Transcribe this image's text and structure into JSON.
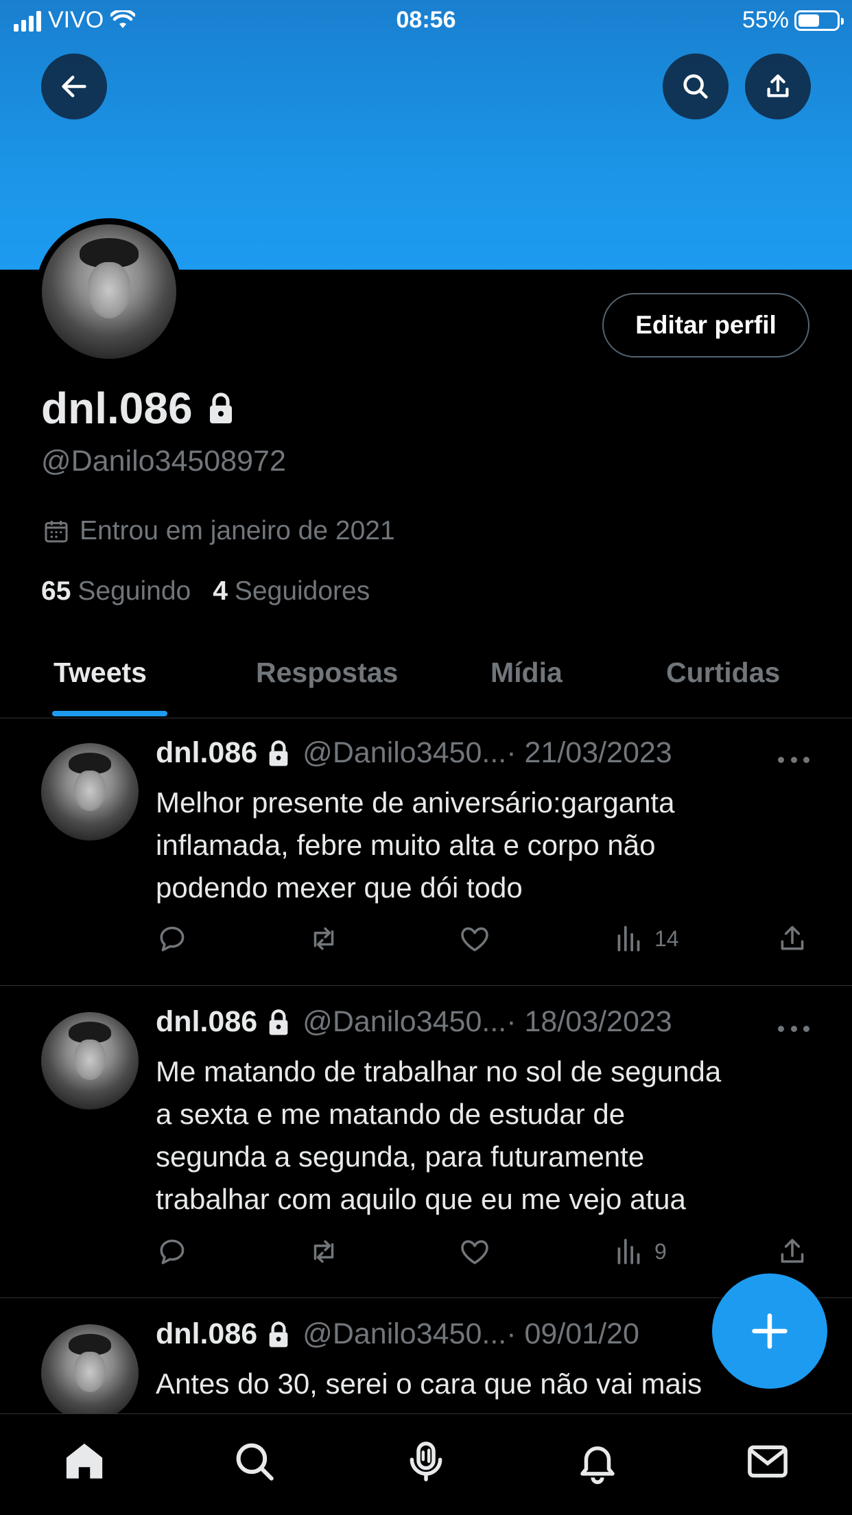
{
  "status_bar": {
    "carrier": "VIVO",
    "time": "08:56",
    "battery": "55%",
    "battery_level": 0.55
  },
  "header": {
    "back_icon": "arrow-left-icon",
    "search_icon": "search-icon",
    "share_icon": "share-icon"
  },
  "profile": {
    "display_name": "dnl.086",
    "handle": "@Danilo34508972",
    "edit_button": "Editar perfil",
    "joined": "Entrou em janeiro de 2021",
    "following_count": "65",
    "following_label": "Seguindo",
    "followers_count": "4",
    "followers_label": "Seguidores"
  },
  "tabs": [
    {
      "label": "Tweets",
      "active": true
    },
    {
      "label": "Respostas",
      "active": false
    },
    {
      "label": "Mídia",
      "active": false
    },
    {
      "label": "Curtidas",
      "active": false
    }
  ],
  "tweets": [
    {
      "name": "dnl.086",
      "handle": "@Danilo3450...",
      "date": "· 21/03/2023",
      "lines": [
        "Melhor presente de aniversário:garganta",
        "inflamada, febre muito alta e corpo não",
        "podendo mexer que dói todo"
      ],
      "views": "14"
    },
    {
      "name": "dnl.086",
      "handle": "@Danilo3450...",
      "date": "· 18/03/2023",
      "lines": [
        "Me matando de trabalhar no sol de segunda",
        "a sexta e me matando de estudar de",
        "segunda a segunda, para futuramente",
        "trabalhar com aquilo que eu me vejo atua"
      ],
      "views": "9"
    },
    {
      "name": "dnl.086",
      "handle": "@Danilo3450...",
      "date": "· 09/01/20",
      "lines": [
        "Antes do 30, serei o cara que não vai mais"
      ]
    }
  ],
  "colors": {
    "accent": "#1d9bf0",
    "background": "#000000",
    "muted": "#71767b"
  },
  "bottom_nav": [
    "home-icon",
    "search-icon",
    "spaces-icon",
    "bell-icon",
    "mail-icon"
  ]
}
